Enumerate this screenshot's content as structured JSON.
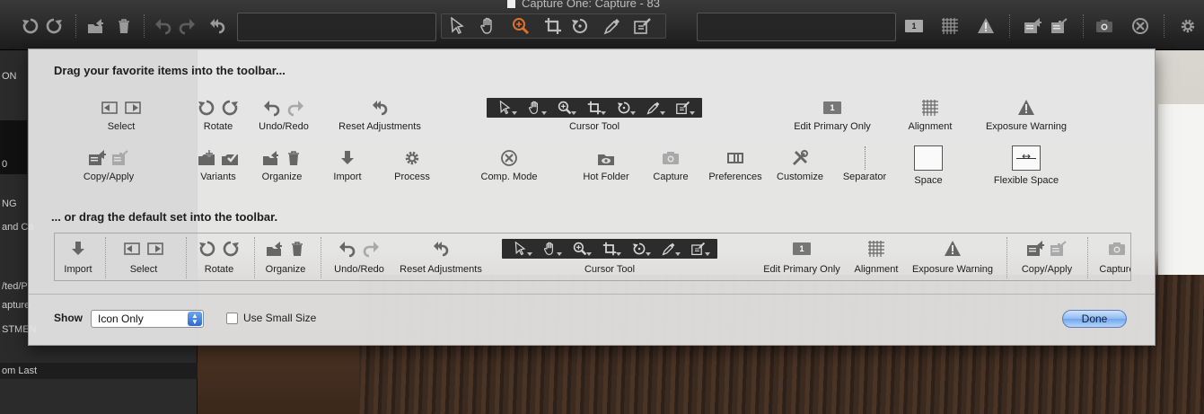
{
  "window": {
    "title": "Capture One: Capture - 83"
  },
  "left_panel": {
    "rows": [
      "ON",
      "0",
      "NG",
      "and Ca",
      "/ted/P",
      "apture",
      "STMEN",
      "om Last"
    ]
  },
  "sheet": {
    "heading_favorites": "Drag your favorite items into the toolbar...",
    "heading_default": "... or drag the default set into the toolbar.",
    "favorites_row1": [
      {
        "label": "Select",
        "icons": [
          "select-icon",
          "select-alt-icon"
        ]
      },
      {
        "label": "Rotate",
        "icons": [
          "rotate-left-icon",
          "rotate-right-icon"
        ]
      },
      {
        "label": "Undo/Redo",
        "icons": [
          "undo-icon",
          "redo-icon"
        ]
      },
      {
        "label": "Reset Adjustments",
        "icons": [
          "reset-icon"
        ]
      },
      {
        "label": "Cursor Tool",
        "icons": [
          "pointer-icon",
          "hand-icon",
          "zoom-icon",
          "crop-icon",
          "rotate-cursor-icon",
          "picker-icon",
          "stamp-icon"
        ]
      },
      {
        "label": "Edit Primary Only",
        "icons": [
          "badge-1-icon"
        ]
      },
      {
        "label": "Alignment",
        "icons": [
          "grid-icon"
        ]
      },
      {
        "label": "Exposure Warning",
        "icons": [
          "warning-icon"
        ]
      }
    ],
    "favorites_row2": [
      {
        "label": "Copy/Apply",
        "icons": [
          "copy-icon",
          "apply-icon"
        ]
      },
      {
        "label": "Variants",
        "icons": [
          "new-variant-icon",
          "clone-variant-icon"
        ]
      },
      {
        "label": "Organize",
        "icons": [
          "move-icon",
          "trash-icon"
        ]
      },
      {
        "label": "Import",
        "icons": [
          "import-icon"
        ]
      },
      {
        "label": "Process",
        "icons": [
          "gear-icon"
        ]
      },
      {
        "label": "Comp. Mode",
        "icons": [
          "comp-mode-icon"
        ]
      },
      {
        "label": "Hot Folder",
        "icons": [
          "hot-folder-icon"
        ]
      },
      {
        "label": "Capture",
        "icons": [
          "camera-icon"
        ]
      },
      {
        "label": "Preferences",
        "icons": [
          "preferences-icon"
        ]
      },
      {
        "label": "Customize",
        "icons": [
          "tools-icon"
        ]
      },
      {
        "label": "Separator",
        "icons": [
          "separator-icon"
        ]
      },
      {
        "label": "Space",
        "icons": [
          "space-icon"
        ]
      },
      {
        "label": "Flexible Space",
        "icons": [
          "flexible-space-icon"
        ]
      }
    ],
    "default_set": [
      "Import",
      "Select",
      "Rotate",
      "Organize",
      "Undo/Redo",
      "Reset Adjustments",
      "Cursor Tool",
      "Edit Primary Only",
      "Alignment",
      "Exposure Warning",
      "Copy/Apply",
      "Capture"
    ],
    "show_label": "Show",
    "show_value": "Icon Only",
    "small_size_label": "Use Small Size",
    "small_size_checked": false,
    "done_label": "Done",
    "badge_text": "1"
  },
  "colors": {
    "sheet_bg": "#e6e6e6",
    "cursor_strip_bg": "#2c2c2c",
    "zoom_active": "#e0702a",
    "done_button": "#6fa6ee"
  }
}
